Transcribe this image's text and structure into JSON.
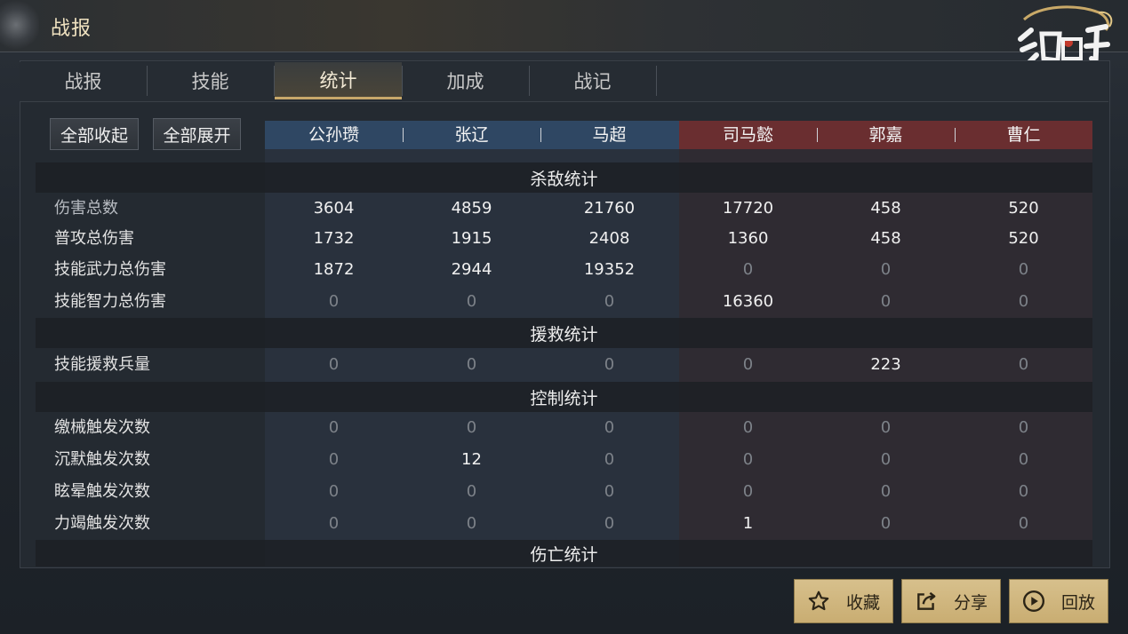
{
  "header": {
    "title": "战报"
  },
  "tabs": [
    {
      "label": "战报"
    },
    {
      "label": "技能"
    },
    {
      "label": "统计"
    },
    {
      "label": "加成"
    },
    {
      "label": "战记"
    }
  ],
  "active_tab": "统计",
  "controls": {
    "collapse_all": "全部收起",
    "expand_all": "全部展开"
  },
  "heroes": {
    "blue": [
      "公孙瓒",
      "张辽",
      "马超"
    ],
    "red": [
      "司马懿",
      "郭嘉",
      "曹仁"
    ]
  },
  "sections": {
    "kill": {
      "title": "杀敌统计",
      "rows": [
        {
          "label": "伤害总数",
          "values": [
            "3604",
            "4859",
            "21760",
            "17720",
            "458",
            "520"
          ]
        },
        {
          "label": "普攻总伤害",
          "values": [
            "1732",
            "1915",
            "2408",
            "1360",
            "458",
            "520"
          ]
        },
        {
          "label": "技能武力总伤害",
          "values": [
            "1872",
            "2944",
            "19352",
            "0",
            "0",
            "0"
          ]
        },
        {
          "label": "技能智力总伤害",
          "values": [
            "0",
            "0",
            "0",
            "16360",
            "0",
            "0"
          ]
        }
      ]
    },
    "rescue": {
      "title": "援救统计",
      "rows": [
        {
          "label": "技能援救兵量",
          "values": [
            "0",
            "0",
            "0",
            "0",
            "223",
            "0"
          ]
        }
      ]
    },
    "control": {
      "title": "控制统计",
      "rows": [
        {
          "label": "缴械触发次数",
          "values": [
            "0",
            "0",
            "0",
            "0",
            "0",
            "0"
          ]
        },
        {
          "label": "沉默触发次数",
          "values": [
            "0",
            "12",
            "0",
            "0",
            "0",
            "0"
          ]
        },
        {
          "label": "眩晕触发次数",
          "values": [
            "0",
            "0",
            "0",
            "0",
            "0",
            "0"
          ]
        },
        {
          "label": "力竭触发次数",
          "values": [
            "0",
            "0",
            "0",
            "1",
            "0",
            "0"
          ]
        }
      ]
    },
    "casualty": {
      "title": "伤亡统计"
    }
  },
  "footer": {
    "favorite": "收藏",
    "share": "分享",
    "replay": "回放"
  },
  "colors": {
    "ally_band": "#2f4763",
    "enemy_band": "#6a2e30",
    "gold_button": "#d0b57e",
    "active_tab_underline": "#c8a86a"
  }
}
